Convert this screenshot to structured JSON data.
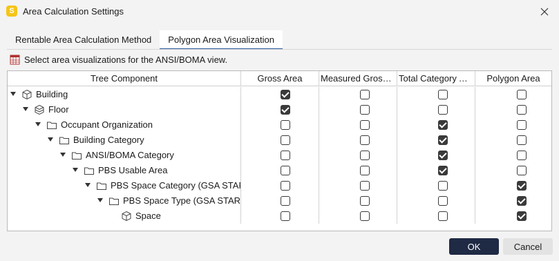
{
  "window": {
    "title": "Area Calculation Settings",
    "app_icon_letter": "S"
  },
  "tabs": [
    {
      "label": "Rentable Area Calculation Method",
      "active": false
    },
    {
      "label": "Polygon Area Visualization",
      "active": true
    }
  ],
  "instruction": "Select area visualizations for the ANSI/BOMA view.",
  "grid": {
    "columns": [
      "Tree Component",
      "Gross Area",
      "Measured Gross ...",
      "Total Category Ar...",
      "Polygon Area"
    ],
    "rows": [
      {
        "label": "Building",
        "depth": 0,
        "icon": "cube-icon",
        "expandable": true,
        "checks": [
          true,
          false,
          false,
          false
        ]
      },
      {
        "label": "Floor",
        "depth": 1,
        "icon": "layers-icon",
        "expandable": true,
        "checks": [
          true,
          false,
          false,
          false
        ]
      },
      {
        "label": "Occupant Organization",
        "depth": 2,
        "icon": "folder-icon",
        "expandable": true,
        "checks": [
          false,
          false,
          true,
          false
        ]
      },
      {
        "label": "Building Category",
        "depth": 3,
        "icon": "folder-icon",
        "expandable": true,
        "checks": [
          false,
          false,
          true,
          false
        ]
      },
      {
        "label": "ANSI/BOMA Category",
        "depth": 4,
        "icon": "folder-icon",
        "expandable": true,
        "checks": [
          false,
          false,
          true,
          false
        ]
      },
      {
        "label": "PBS Usable Area",
        "depth": 5,
        "icon": "folder-icon",
        "expandable": true,
        "checks": [
          false,
          false,
          true,
          false
        ]
      },
      {
        "label": "PBS Space Category (GSA STAR S",
        "depth": 6,
        "icon": "folder-icon",
        "expandable": true,
        "checks": [
          false,
          false,
          false,
          true
        ]
      },
      {
        "label": "PBS Space Type (GSA STAR Sp",
        "depth": 7,
        "icon": "folder-icon",
        "expandable": true,
        "checks": [
          false,
          false,
          false,
          true
        ]
      },
      {
        "label": "Space",
        "depth": 8,
        "icon": "cube-icon",
        "expandable": false,
        "checks": [
          false,
          false,
          false,
          true
        ]
      }
    ]
  },
  "buttons": {
    "ok": "OK",
    "cancel": "Cancel"
  },
  "colors": {
    "accent": "#2b5a9c",
    "primary_button": "#1f2a44",
    "app_icon": "#f5c518"
  }
}
